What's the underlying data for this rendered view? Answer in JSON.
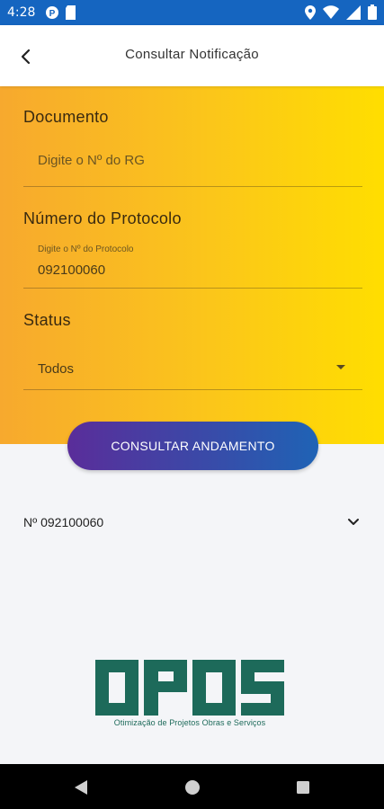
{
  "status_bar": {
    "time": "4:28",
    "left_icons": [
      "podcast-app-icon",
      "sd-card-icon"
    ],
    "right_icons": [
      "location-icon",
      "wifi-icon",
      "signal-icon",
      "battery-icon"
    ]
  },
  "app_bar": {
    "title": "Consultar Notificação",
    "back_icon": "back-arrow-icon"
  },
  "form": {
    "documento": {
      "label": "Documento",
      "placeholder": "Digite o Nº do RG",
      "value": ""
    },
    "protocolo": {
      "label": "Número do Protocolo",
      "floating_label": "Digite o Nº do Protocolo",
      "value": "092100060"
    },
    "status": {
      "label": "Status",
      "selected": "Todos"
    },
    "submit_label": "CONSULTAR ANDAMENTO"
  },
  "results": [
    {
      "label": "Nº 092100060"
    }
  ],
  "logo": {
    "text": "OPOS",
    "tagline": "Otimização de Projetos Obras e Serviços"
  },
  "colors": {
    "status_bar": "#1565c0",
    "gradient_start": "#f7a92e",
    "gradient_end": "#ffde00",
    "button_start": "#5a2d9a",
    "button_end": "#1f63b5",
    "logo_green": "#1d6a5a"
  }
}
